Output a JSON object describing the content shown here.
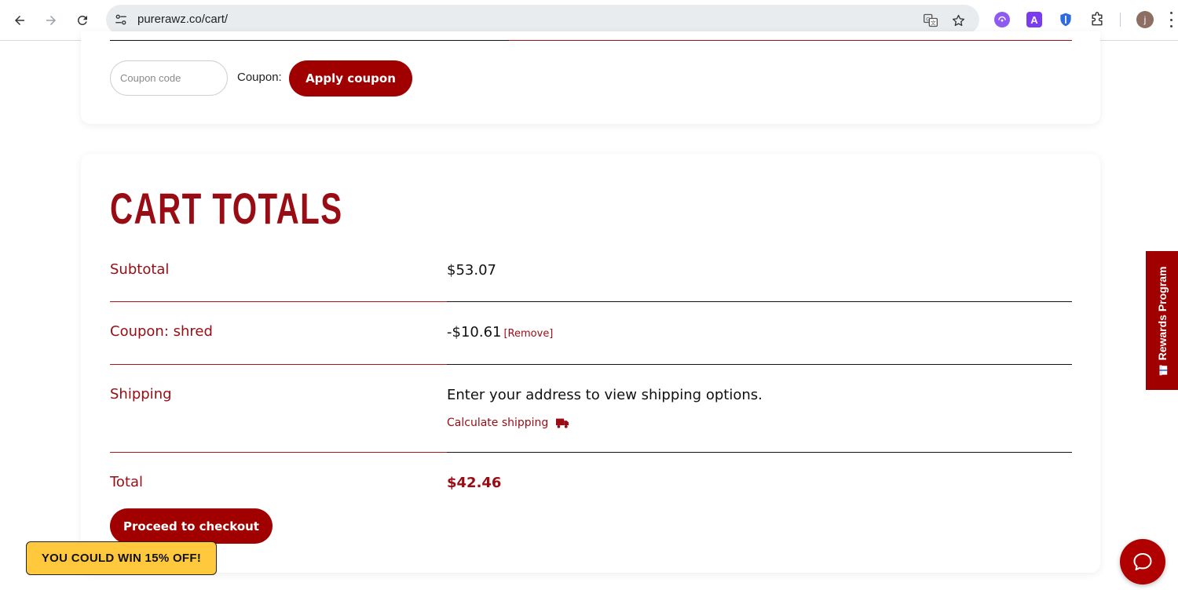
{
  "browser": {
    "url": "purerawz.co/cart/",
    "avatar_letter": "j"
  },
  "coupon": {
    "placeholder": "Coupon code",
    "label": "Coupon:",
    "apply_label": "Apply coupon"
  },
  "cart_totals": {
    "title": "CART TOTALS",
    "subtotal_label": "Subtotal",
    "subtotal_value": "$53.07",
    "coupon_label": "Coupon: shred",
    "coupon_value": "-$10.61",
    "coupon_remove": "[Remove]",
    "shipping_label": "Shipping",
    "shipping_value": "Enter your address to view shipping options.",
    "calc_shipping": "Calculate shipping",
    "total_label": "Total",
    "total_value": "$42.46",
    "checkout_label": "Proceed to checkout"
  },
  "overlays": {
    "promo": "YOU COULD WIN 15% OFF!",
    "rewards": "Rewards Program"
  },
  "colors": {
    "brand_red": "#a00000",
    "label_red": "#9a0c14",
    "promo_yellow": "#ffc83d"
  },
  "icons": {
    "back": "arrow-left-icon",
    "forward": "arrow-right-icon",
    "reload": "reload-icon",
    "site_settings": "tune-icon",
    "translate": "translate-icon",
    "bookmark": "star-icon",
    "calc_shipping": "truck-icon",
    "rewards": "gift-icon",
    "chat": "chat-bubble-icon"
  }
}
